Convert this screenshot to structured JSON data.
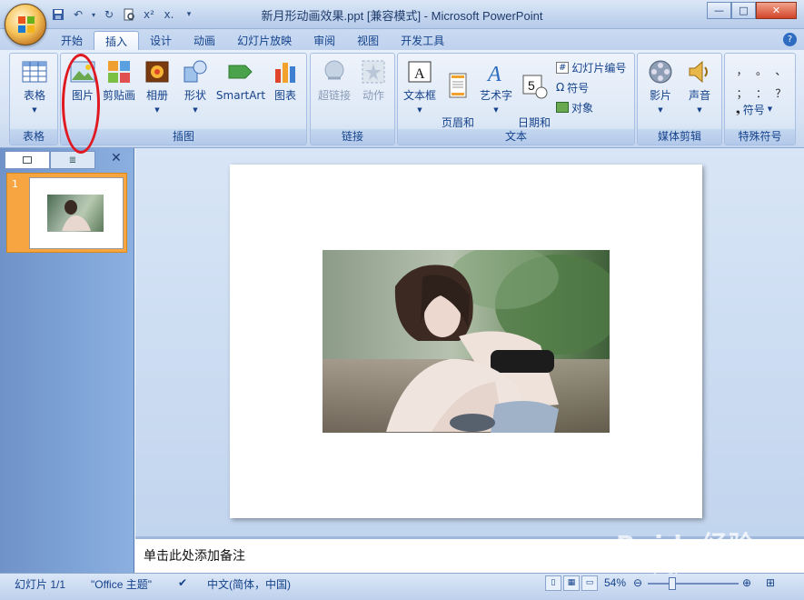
{
  "window": {
    "title": "新月形动画效果.ppt [兼容模式] - Microsoft PowerPoint",
    "controls": {
      "minimize": "—",
      "maximize": "□",
      "close": "✕"
    }
  },
  "quick_access": [
    "save-icon",
    "undo-icon",
    "redo-icon",
    "print-preview-icon",
    "clear-format-icon",
    "close-icon",
    "customize-icon"
  ],
  "tabs": [
    {
      "label": "开始",
      "active": false
    },
    {
      "label": "插入",
      "active": true
    },
    {
      "label": "设计",
      "active": false
    },
    {
      "label": "动画",
      "active": false
    },
    {
      "label": "幻灯片放映",
      "active": false
    },
    {
      "label": "审阅",
      "active": false
    },
    {
      "label": "视图",
      "active": false
    },
    {
      "label": "开发工具",
      "active": false
    }
  ],
  "ribbon": {
    "groups": {
      "table": {
        "label": "表格",
        "button": "表格"
      },
      "illustrations": {
        "label": "插图",
        "buttons": [
          "图片",
          "剪贴画",
          "相册",
          "形状",
          "SmartArt",
          "图表"
        ]
      },
      "links": {
        "label": "链接",
        "buttons": [
          "超链接",
          "动作"
        ]
      },
      "text": {
        "label": "文本",
        "buttons": [
          "文本框",
          "页眉和\n页脚",
          "艺术字",
          "日期和\n时间"
        ],
        "small": [
          "幻灯片编号",
          "符号",
          "对象"
        ]
      },
      "media": {
        "label": "媒体剪辑",
        "buttons": [
          "影片",
          "声音"
        ]
      },
      "special": {
        "label": "特殊符号",
        "button": "符号",
        "symbols": [
          "，",
          "。",
          "、",
          "；",
          "：",
          "？"
        ]
      }
    }
  },
  "slide_panel": {
    "slide_number": "1"
  },
  "notes": {
    "placeholder": "单击此处添加备注"
  },
  "status": {
    "slide": "幻灯片 1/1",
    "theme": "\"Office 主题\"",
    "language": "中文(简体，中国)",
    "zoom": "54%"
  },
  "watermark": {
    "main": "Baidu经验",
    "sub": "jingyan.baidu.com"
  },
  "colors": {
    "annotation": "#e0181f",
    "ribbon_text": "#15428b",
    "selected_slide": "#f7a541"
  }
}
